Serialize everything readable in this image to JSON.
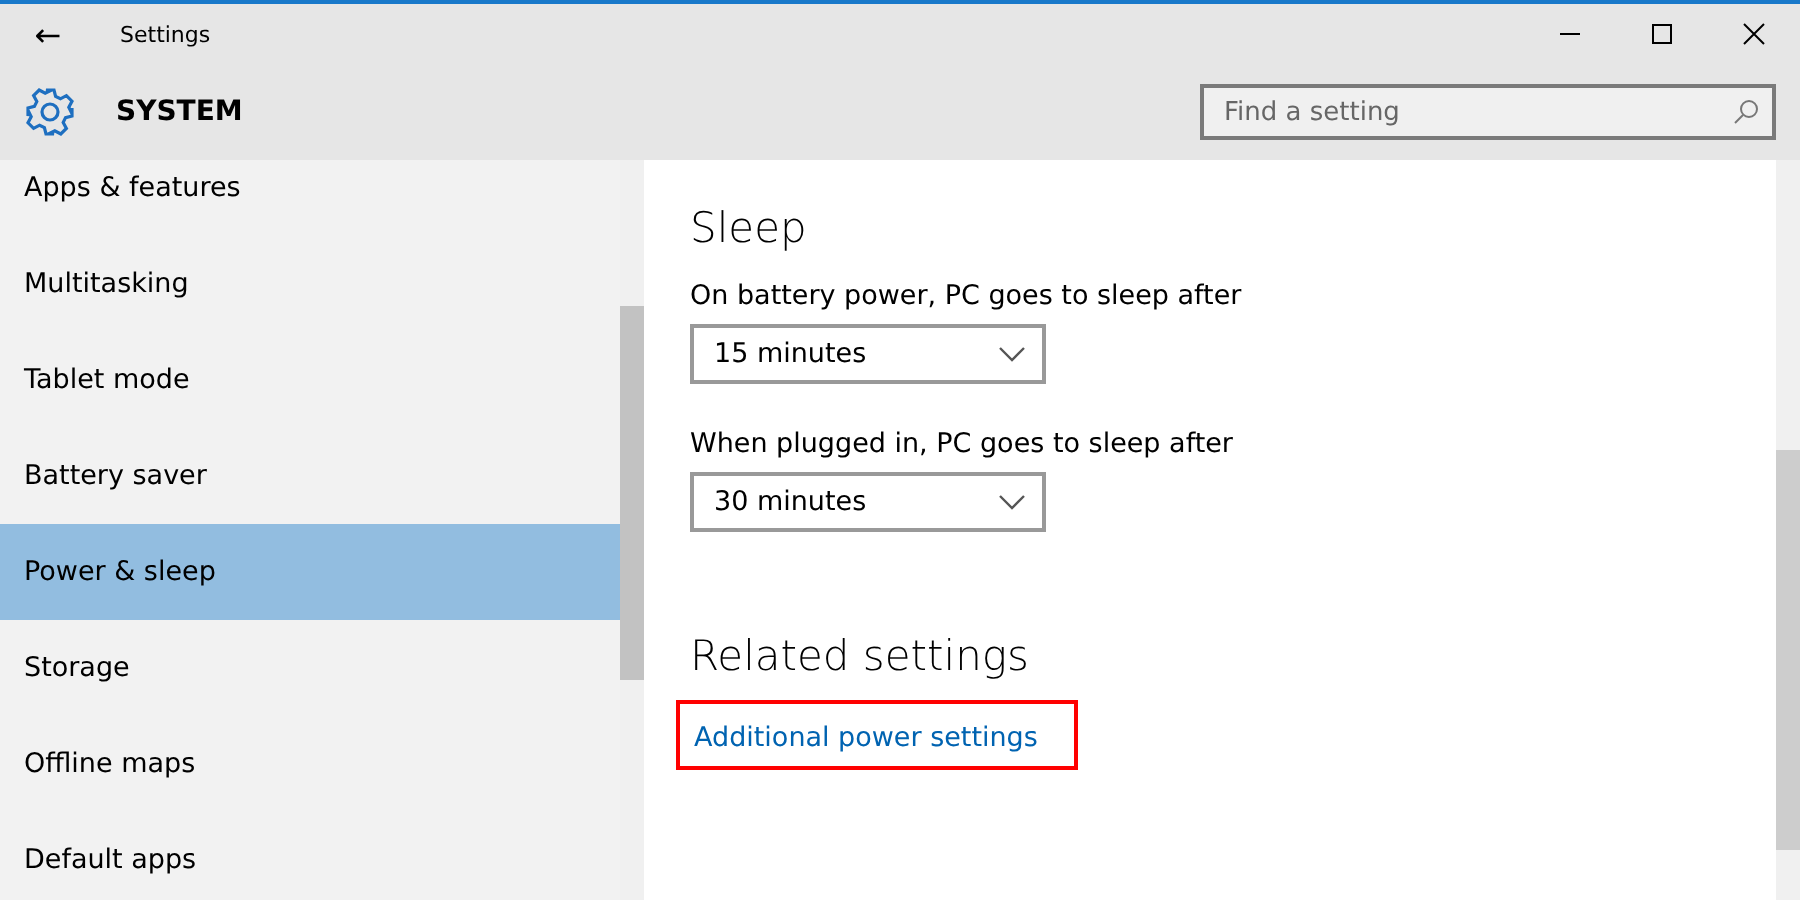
{
  "window": {
    "title": "Settings",
    "back": "←"
  },
  "header": {
    "title": "SYSTEM"
  },
  "search": {
    "placeholder": "Find a setting"
  },
  "sidebar": {
    "items": [
      {
        "label": "Apps & features",
        "selected": false
      },
      {
        "label": "Multitasking",
        "selected": false
      },
      {
        "label": "Tablet mode",
        "selected": false
      },
      {
        "label": "Battery saver",
        "selected": false
      },
      {
        "label": "Power & sleep",
        "selected": true
      },
      {
        "label": "Storage",
        "selected": false
      },
      {
        "label": "Offline maps",
        "selected": false
      },
      {
        "label": "Default apps",
        "selected": false
      }
    ]
  },
  "sleep": {
    "title": "Sleep",
    "settings": [
      {
        "label": "On battery power, PC goes to sleep after",
        "value": "15 minutes"
      },
      {
        "label": "When plugged in, PC goes to sleep after",
        "value": "30 minutes"
      }
    ]
  },
  "related": {
    "title": "Related settings",
    "link": {
      "label": "Additional power settings",
      "highlighted": true
    }
  }
}
